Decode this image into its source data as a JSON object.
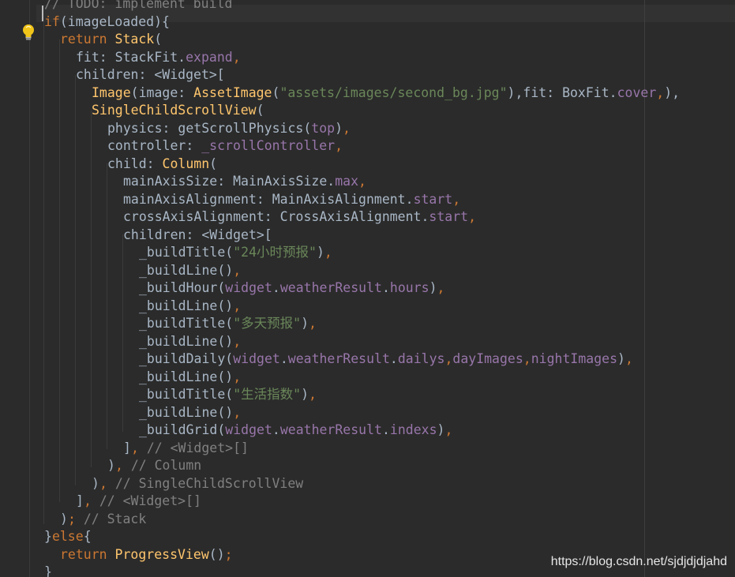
{
  "lines": [
    [
      [
        "cmt",
        "// TODO: implement build"
      ]
    ],
    [
      [
        "kw",
        "if"
      ],
      [
        "pl",
        "(imageLoaded){"
      ]
    ],
    [
      [
        "kw",
        "return "
      ],
      [
        "cls",
        "Stack"
      ],
      [
        "pl",
        "("
      ]
    ],
    [
      [
        "pl",
        "fit: StackFit."
      ],
      [
        "fld",
        "expand"
      ],
      [
        "kw",
        ","
      ]
    ],
    [
      [
        "pl",
        "children: <Widget>["
      ]
    ],
    [
      [
        "cls",
        "Image"
      ],
      [
        "pl",
        "(image: "
      ],
      [
        "cls",
        "AssetImage"
      ],
      [
        "pl",
        "("
      ],
      [
        "str",
        "\"assets/images/second_bg.jpg\""
      ],
      [
        "pl",
        "),fit: BoxFit."
      ],
      [
        "fld",
        "cover"
      ],
      [
        "kw",
        ","
      ],
      [
        "pl",
        "),"
      ]
    ],
    [
      [
        "cls",
        "SingleChildScrollView"
      ],
      [
        "pl",
        "("
      ]
    ],
    [
      [
        "pl",
        "physics: getScrollPhysics("
      ],
      [
        "fld",
        "top"
      ],
      [
        "pl",
        ")"
      ],
      [
        "kw",
        ","
      ]
    ],
    [
      [
        "pl",
        "controller: "
      ],
      [
        "fld",
        "_scrollController"
      ],
      [
        "kw",
        ","
      ]
    ],
    [
      [
        "pl",
        "child: "
      ],
      [
        "cls",
        "Column"
      ],
      [
        "pl",
        "("
      ]
    ],
    [
      [
        "pl",
        "mainAxisSize: MainAxisSize."
      ],
      [
        "fld",
        "max"
      ],
      [
        "kw",
        ","
      ]
    ],
    [
      [
        "pl",
        "mainAxisAlignment: MainAxisAlignment."
      ],
      [
        "fld",
        "start"
      ],
      [
        "kw",
        ","
      ]
    ],
    [
      [
        "pl",
        "crossAxisAlignment: CrossAxisAlignment."
      ],
      [
        "fld",
        "start"
      ],
      [
        "kw",
        ","
      ]
    ],
    [
      [
        "pl",
        "children: <Widget>["
      ]
    ],
    [
      [
        "pl",
        "_buildTitle("
      ],
      [
        "str",
        "\"24小时预报\""
      ],
      [
        "pl",
        ")"
      ],
      [
        "kw",
        ","
      ]
    ],
    [
      [
        "pl",
        "_buildLine()"
      ],
      [
        "kw",
        ","
      ]
    ],
    [
      [
        "pl",
        "_buildHour("
      ],
      [
        "fld",
        "widget"
      ],
      [
        "pl",
        "."
      ],
      [
        "fld",
        "weatherResult"
      ],
      [
        "pl",
        "."
      ],
      [
        "fld",
        "hours"
      ],
      [
        "pl",
        ")"
      ],
      [
        "kw",
        ","
      ]
    ],
    [
      [
        "pl",
        "_buildLine()"
      ],
      [
        "kw",
        ","
      ]
    ],
    [
      [
        "pl",
        "_buildTitle("
      ],
      [
        "str",
        "\"多天预报\""
      ],
      [
        "pl",
        ")"
      ],
      [
        "kw",
        ","
      ]
    ],
    [
      [
        "pl",
        "_buildLine()"
      ],
      [
        "kw",
        ","
      ]
    ],
    [
      [
        "pl",
        "_buildDaily("
      ],
      [
        "fld",
        "widget"
      ],
      [
        "pl",
        "."
      ],
      [
        "fld",
        "weatherResult"
      ],
      [
        "pl",
        "."
      ],
      [
        "fld",
        "dailys"
      ],
      [
        "kw",
        ","
      ],
      [
        "fld",
        "dayImages"
      ],
      [
        "kw",
        ","
      ],
      [
        "fld",
        "nightImages"
      ],
      [
        "pl",
        ")"
      ],
      [
        "kw",
        ","
      ]
    ],
    [
      [
        "pl",
        "_buildLine()"
      ],
      [
        "kw",
        ","
      ]
    ],
    [
      [
        "pl",
        "_buildTitle("
      ],
      [
        "str",
        "\"生活指数\""
      ],
      [
        "pl",
        ")"
      ],
      [
        "kw",
        ","
      ]
    ],
    [
      [
        "pl",
        "_buildLine()"
      ],
      [
        "kw",
        ","
      ]
    ],
    [
      [
        "pl",
        "_buildGrid("
      ],
      [
        "fld",
        "widget"
      ],
      [
        "pl",
        "."
      ],
      [
        "fld",
        "weatherResult"
      ],
      [
        "pl",
        "."
      ],
      [
        "fld",
        "indexs"
      ],
      [
        "pl",
        ")"
      ],
      [
        "kw",
        ","
      ]
    ],
    [
      [
        "pl",
        "]"
      ],
      [
        "kw",
        ", "
      ],
      [
        "cmt",
        "// <Widget>[]"
      ]
    ],
    [
      [
        "pl",
        ")"
      ],
      [
        "kw",
        ", "
      ],
      [
        "cmt",
        "// Column"
      ]
    ],
    [
      [
        "pl",
        ")"
      ],
      [
        "kw",
        ", "
      ],
      [
        "cmt",
        "// SingleChildScrollView"
      ]
    ],
    [
      [
        "pl",
        "]"
      ],
      [
        "kw",
        ", "
      ],
      [
        "cmt",
        "// <Widget>[]"
      ]
    ],
    [
      [
        "pl",
        ")"
      ],
      [
        "kw",
        "; "
      ],
      [
        "cmt",
        "// Stack"
      ]
    ],
    [
      [
        "pl",
        "}"
      ],
      [
        "kw",
        "else"
      ],
      [
        "pl",
        "{"
      ]
    ],
    [
      [
        "kw",
        "return "
      ],
      [
        "cls",
        "ProgressView"
      ],
      [
        "pl",
        "()"
      ],
      [
        "kw",
        ";"
      ]
    ],
    [
      [
        "pl",
        "}"
      ]
    ]
  ],
  "watermark": "https://blog.csdn.net/sjdjdjdjahd",
  "icons": {
    "intention": "lightbulb-icon"
  },
  "colors": {
    "background": "#2b2b2b",
    "keyword": "#cc7832",
    "class": "#ffc66d",
    "field": "#9876aa",
    "string": "#6a8759",
    "comment": "#808080",
    "plain": "#a9b7c6"
  }
}
